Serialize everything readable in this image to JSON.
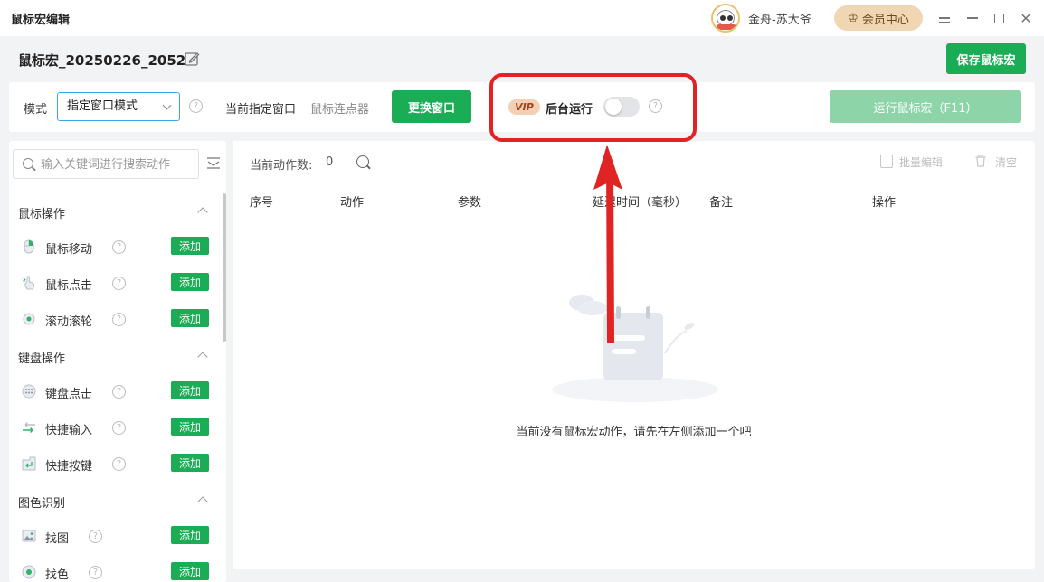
{
  "window": {
    "title": "鼠标宏编辑",
    "user_name": "金舟-苏大爷",
    "vip_center_label": "会员中心"
  },
  "macro": {
    "name": "鼠标宏_20250226_2052",
    "save_label": "保存鼠标宏"
  },
  "mode_bar": {
    "mode_label": "模式",
    "mode_selected": "指定窗口模式",
    "target_label": "当前指定窗口",
    "target_value": "鼠标连点器",
    "switch_window_label": "更换窗口",
    "vip_tag": "VIP",
    "background_run_label": "后台运行",
    "background_run_enabled": false,
    "run_label": "运行鼠标宏（F11）"
  },
  "sidebar": {
    "search_placeholder": "输入关键词进行搜索动作",
    "add_label": "添加",
    "sections": [
      {
        "title": "鼠标操作",
        "items": [
          {
            "label": "鼠标移动",
            "icon": "mouse-move-icon"
          },
          {
            "label": "鼠标点击",
            "icon": "mouse-click-icon"
          },
          {
            "label": "滚动滚轮",
            "icon": "scroll-wheel-icon"
          }
        ]
      },
      {
        "title": "键盘操作",
        "items": [
          {
            "label": "键盘点击",
            "icon": "keyboard-icon"
          },
          {
            "label": "快捷输入",
            "icon": "quick-input-icon"
          },
          {
            "label": "快捷按键",
            "icon": "enter-key-icon"
          }
        ]
      },
      {
        "title": "图色识别",
        "items": [
          {
            "label": "找图",
            "icon": "image-icon"
          },
          {
            "label": "找色",
            "icon": "color-icon"
          }
        ]
      }
    ]
  },
  "main": {
    "count_label": "当前动作数:",
    "count_value": "0",
    "batch_edit_label": "批量编辑",
    "clear_label": "清空",
    "columns": [
      "序号",
      "动作",
      "参数",
      "延迟时间（毫秒）",
      "备注",
      "操作"
    ],
    "empty_text": "当前没有鼠标宏动作，请先在左侧添加一个吧"
  },
  "colors": {
    "primary_green": "#1aad55",
    "disabled_green": "#8dd5a8",
    "highlight_red": "#e02424",
    "vip_gold": "#f0d6b2"
  }
}
